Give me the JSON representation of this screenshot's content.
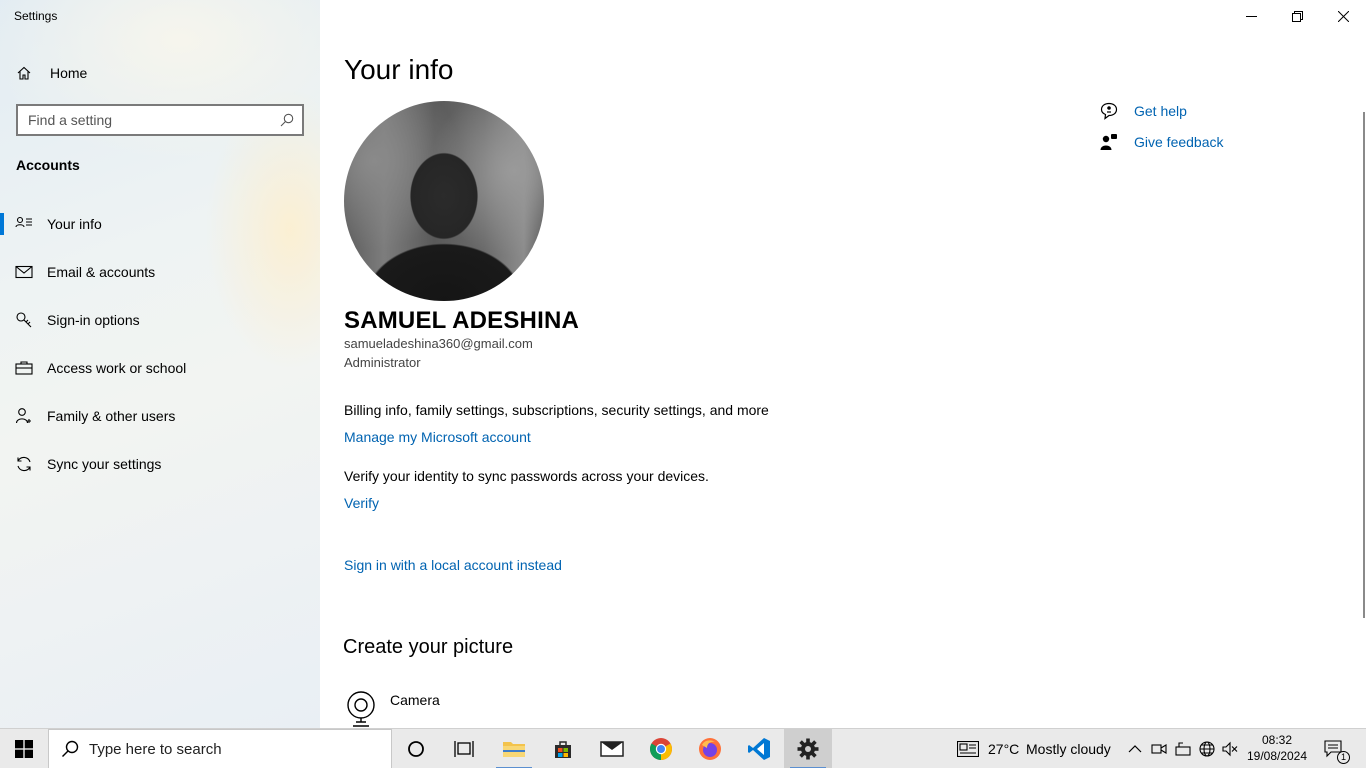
{
  "window": {
    "app_title": "Settings"
  },
  "sidebar": {
    "home_label": "Home",
    "search_placeholder": "Find a setting",
    "section_title": "Accounts",
    "items": [
      {
        "label": "Your info",
        "icon": "person-card-icon",
        "selected": true
      },
      {
        "label": "Email & accounts",
        "icon": "mail-icon",
        "selected": false
      },
      {
        "label": "Sign-in options",
        "icon": "key-icon",
        "selected": false
      },
      {
        "label": "Access work or school",
        "icon": "briefcase-icon",
        "selected": false
      },
      {
        "label": "Family & other users",
        "icon": "add-person-icon",
        "selected": false
      },
      {
        "label": "Sync your settings",
        "icon": "sync-icon",
        "selected": false
      }
    ]
  },
  "main": {
    "page_title": "Your info",
    "user": {
      "name": "SAMUEL ADESHINA",
      "email": "samueladeshina360@gmail.com",
      "role": "Administrator"
    },
    "billing_text": "Billing info, family settings, subscriptions, security settings, and more",
    "manage_link": "Manage my Microsoft account",
    "verify_text": "Verify your identity to sync passwords across your devices.",
    "verify_link": "Verify",
    "local_account_link": "Sign in with a local account instead",
    "create_picture_title": "Create your picture",
    "camera_label": "Camera",
    "help": {
      "get_help": "Get help",
      "give_feedback": "Give feedback"
    }
  },
  "taskbar": {
    "search_placeholder": "Type here to search",
    "weather": {
      "temperature": "27°C",
      "condition": "Mostly cloudy"
    },
    "clock": {
      "time": "08:32",
      "date": "19/08/2024"
    },
    "notification_count": "1"
  },
  "colors": {
    "accent": "#0078d7",
    "link": "#0063b1"
  }
}
